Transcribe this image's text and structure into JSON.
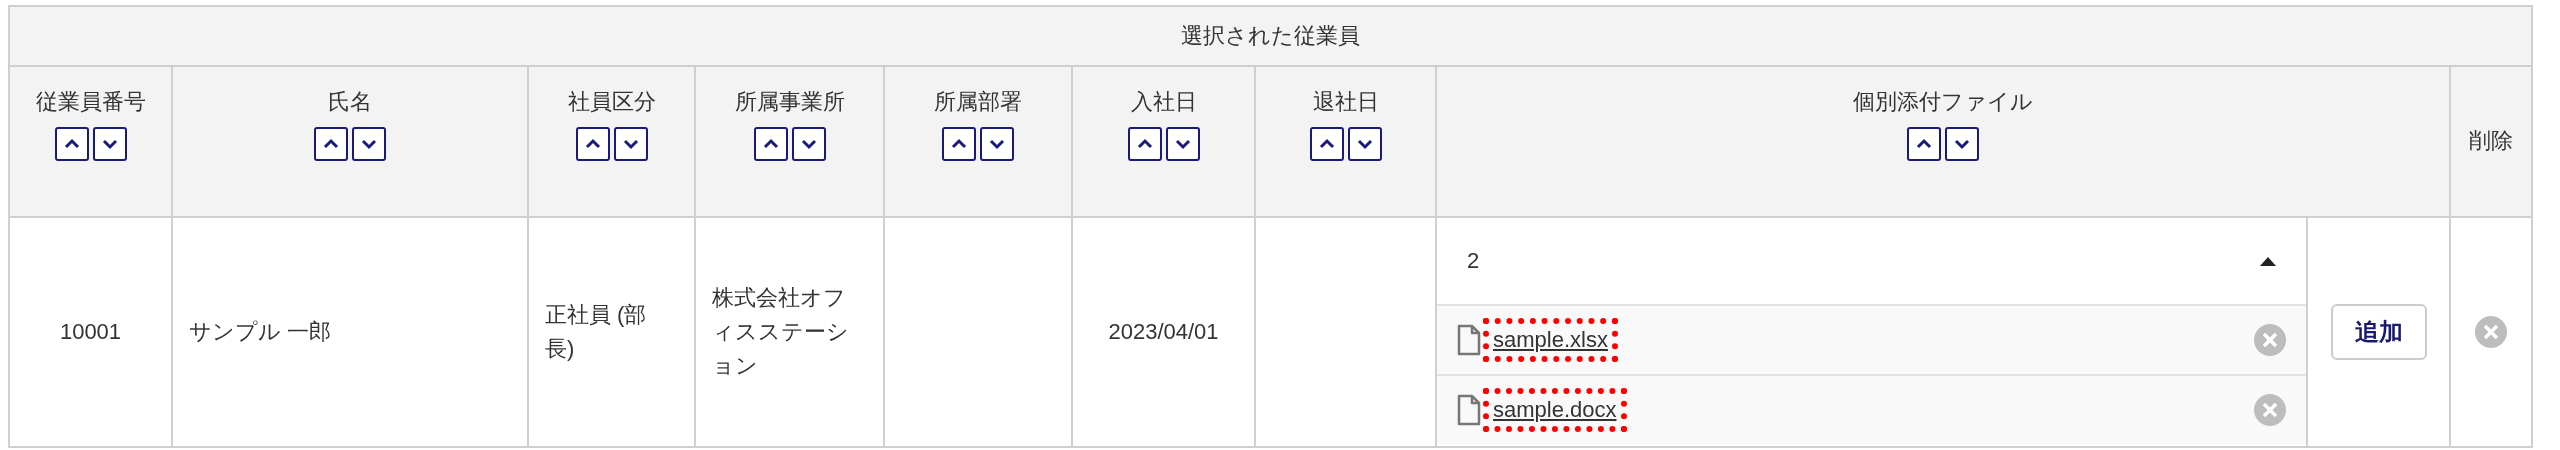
{
  "table": {
    "title": "選択された従業員",
    "columns": [
      {
        "label": "従業員番号",
        "sortable": true
      },
      {
        "label": "氏名",
        "sortable": true
      },
      {
        "label": "社員区分",
        "sortable": true
      },
      {
        "label": "所属事業所",
        "sortable": true
      },
      {
        "label": "所属部署",
        "sortable": true
      },
      {
        "label": "入社日",
        "sortable": true
      },
      {
        "label": "退社日",
        "sortable": true
      },
      {
        "label": "個別添付ファイル",
        "sortable": true
      },
      {
        "label": "削除",
        "sortable": false
      }
    ],
    "rows": [
      {
        "employee_no": "10001",
        "name": "サンプル 一郎",
        "category": "正社員 (部長)",
        "office": "株式会社オフィスステーション",
        "department": "",
        "hire_date": "2023/04/01",
        "leave_date": "",
        "attachments": {
          "count": "2",
          "expanded": true,
          "files": [
            {
              "name": "sample.xlsx",
              "highlighted": true
            },
            {
              "name": "sample.docx",
              "highlighted": true
            }
          ]
        },
        "add_button": "追加"
      }
    ]
  }
}
